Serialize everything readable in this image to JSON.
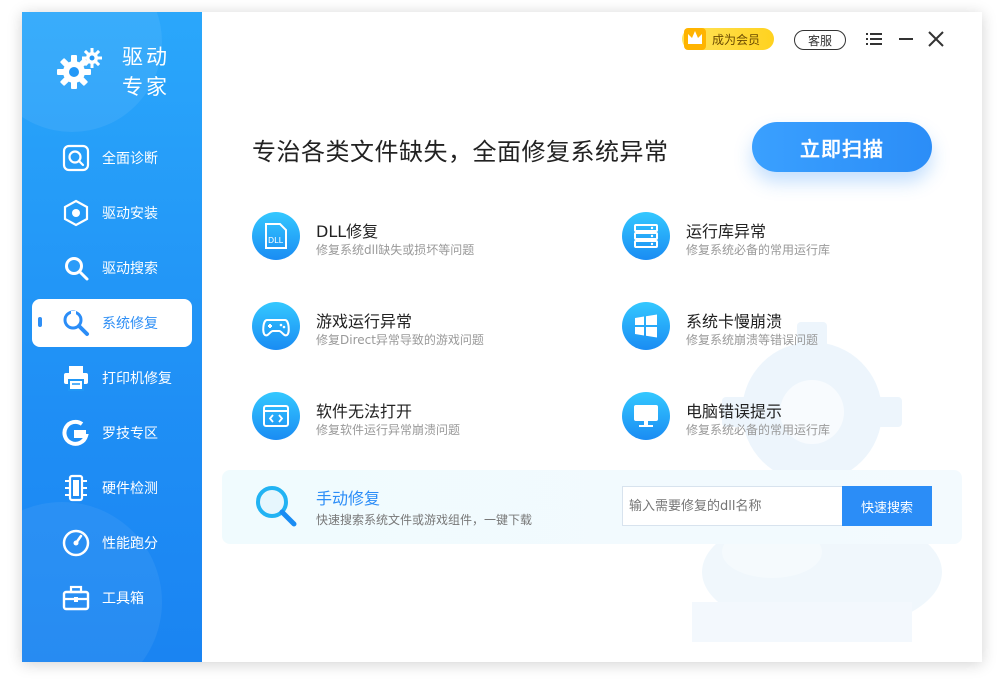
{
  "app": {
    "name": "驱动专家",
    "name_line1": "驱动",
    "name_line2": "专家"
  },
  "topbar": {
    "vip_label": "成为会员",
    "service_label": "客服",
    "menu_icon": "list-menu-icon",
    "minimize_icon": "minimize-icon",
    "close_icon": "close-icon"
  },
  "sidebar": {
    "items": [
      {
        "label": "全面诊断",
        "icon": "diagnose-icon"
      },
      {
        "label": "驱动安装",
        "icon": "driver-install-icon"
      },
      {
        "label": "驱动搜索",
        "icon": "search-icon"
      },
      {
        "label": "系统修复",
        "icon": "wrench-icon",
        "active": true
      },
      {
        "label": "打印机修复",
        "icon": "printer-icon"
      },
      {
        "label": "罗技专区",
        "icon": "logitech-icon"
      },
      {
        "label": "硬件检测",
        "icon": "hardware-icon"
      },
      {
        "label": "性能跑分",
        "icon": "gauge-icon"
      },
      {
        "label": "工具箱",
        "icon": "toolbox-icon"
      }
    ]
  },
  "main": {
    "headline": "专治各类文件缺失，全面修复系统异常",
    "scan_button": "立即扫描",
    "features": [
      {
        "title": "DLL修复",
        "desc": "修复系统dll缺失或损坏等问题",
        "icon": "dll-icon"
      },
      {
        "title": "运行库异常",
        "desc": "修复系统必备的常用运行库",
        "icon": "server-icon"
      },
      {
        "title": "游戏运行异常",
        "desc": "修复Direct异常导致的游戏问题",
        "icon": "gamepad-icon"
      },
      {
        "title": "系统卡慢崩溃",
        "desc": "修复系统崩溃等错误问题",
        "icon": "windows-icon"
      },
      {
        "title": "软件无法打开",
        "desc": "修复软件运行异常崩溃问题",
        "icon": "code-window-icon"
      },
      {
        "title": "电脑错误提示",
        "desc": "修复系统必备的常用运行库",
        "icon": "monitor-icon"
      }
    ],
    "manual": {
      "title": "手动修复",
      "desc": "快速搜索系统文件或游戏组件，一键下载",
      "input_placeholder": "输入需要修复的dll名称",
      "search_button": "快速搜索"
    }
  },
  "colors": {
    "accent": "#2b8df7",
    "sidebar_top": "#2aa7fb",
    "sidebar_bottom": "#1a84f2",
    "vip": "#ffd21f"
  }
}
